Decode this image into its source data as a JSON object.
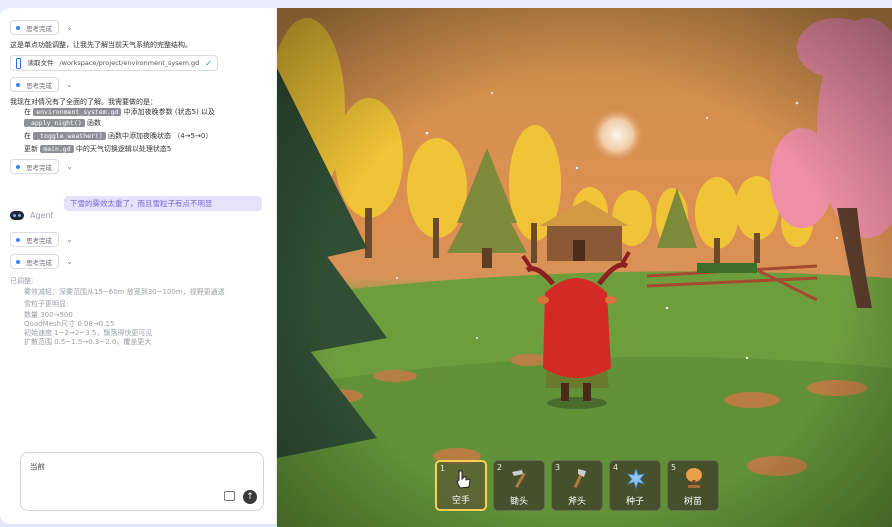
{
  "chat": {
    "think_label": "思考完成",
    "line_structure": "这是单点功能调整，让我先了解当前天气系统的完整结构。",
    "file_action": "读取文件",
    "file_path": "/workspace/project/environment_sysem.gd",
    "line_understood": "我现在对情况有了全面的了解。我需要做的是：",
    "step1_pre": "在",
    "step1_code": "environment_system.gd",
    "step1_post": "中添加夜晚参数 (状态5) 以及",
    "step1b_code": "_apply_night()",
    "step1b_post": "函数",
    "step2_pre": "在",
    "step2_code": "_toggle_weather()",
    "step2_post": "函数中添加夜晚状态 （4→5→0）",
    "step3_pre": "更新",
    "step3_code": "main.gd",
    "step3_post": "中的天气切换逻辑以处理状态5",
    "user_message": "下雪的雾效太重了，而且雪粒子有点不明显",
    "agent_name": "Agent",
    "adjust_title": "已调整:",
    "adjust_lines": [
      "雾效减轻：深雾范围从15~60m 放宽到30~100m，视野更通透",
      "雪粒子更明显:",
      "数量 300→500",
      "QuadMesh尺寸 0.08→0.15",
      "初始速度 1~2→2~3.5，飘落得快更可见",
      "扩散范围 0.5~1.5→0.3~2.0，覆盖更大"
    ],
    "input_value": "当前"
  },
  "hotbar": {
    "slots": [
      {
        "num": "1",
        "label": "空手",
        "icon": "hand-icon"
      },
      {
        "num": "2",
        "label": "锄头",
        "icon": "hoe-icon"
      },
      {
        "num": "3",
        "label": "斧头",
        "icon": "axe-icon"
      },
      {
        "num": "4",
        "label": "种子",
        "icon": "seed-icon"
      },
      {
        "num": "5",
        "label": "树苗",
        "icon": "sapling-icon"
      }
    ],
    "selected": "1"
  },
  "colors": {
    "accent": "#3b82f6",
    "user_bubble_bg": "#e7e2fb",
    "user_bubble_text": "#7766d6",
    "hotbar_selected": "#f4d25a"
  }
}
